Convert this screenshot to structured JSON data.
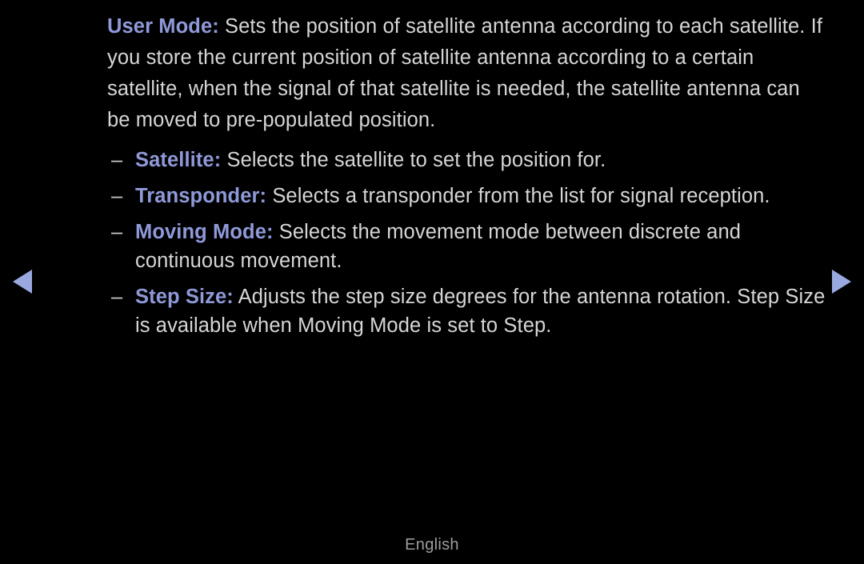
{
  "page": {
    "background_color": "#000000",
    "body_text_color": "#d6d6d6",
    "highlight_color": "#8f99d8",
    "arrow_color": "#9aa8e0",
    "footer_color": "#9d9d9d"
  },
  "intro": {
    "term": "User Mode",
    "separator": ":",
    "text": " Sets the position of satellite antenna according to each satellite. If you store the current position of satellite antenna according to a certain satellite, when the signal of that satellite is needed, the satellite antenna can be moved to pre-populated position."
  },
  "bullets": [
    {
      "dash": "–",
      "term": "Satellite",
      "separator": ":",
      "text": " Selects the satellite to set the position for."
    },
    {
      "dash": "–",
      "term": "Transponder",
      "separator": ":",
      "text": " Selects a transponder from the list for signal reception."
    },
    {
      "dash": "–",
      "term": "Moving Mode",
      "separator": ":",
      "text": " Selects the movement mode between discrete and continuous movement."
    },
    {
      "dash": "–",
      "term": "Step Size",
      "separator": ":",
      "text": " Adjusts the step size degrees for the antenna rotation. Step Size is available when Moving Mode is set to Step."
    }
  ],
  "navigation": {
    "prev_icon": "triangle-left-icon",
    "next_icon": "triangle-right-icon"
  },
  "footer": {
    "language": "English"
  }
}
